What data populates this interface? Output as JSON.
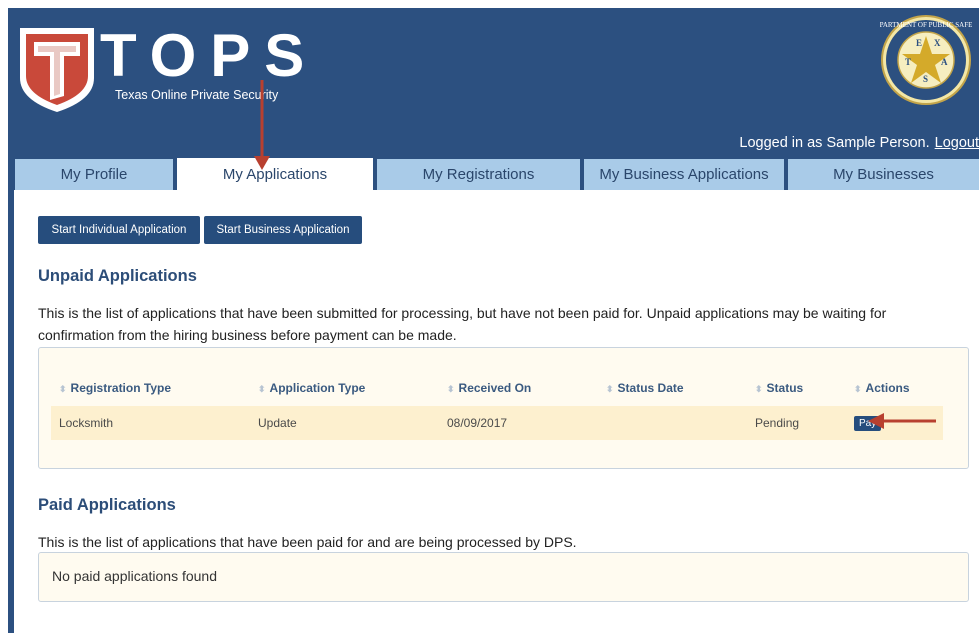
{
  "header": {
    "brand": "TOPS",
    "tagline": "Texas Online Private Security",
    "seal_top_text": "DEPARTMENT OF PUBLIC SAFETY",
    "seal_letters": [
      "E",
      "X",
      "T",
      "A",
      "S"
    ],
    "logged_in_text": "Logged in as Sample Person.",
    "logout_label": "Logout"
  },
  "tabs": [
    {
      "label": "My Profile",
      "active": false
    },
    {
      "label": "My Applications",
      "active": true
    },
    {
      "label": "My Registrations",
      "active": false
    },
    {
      "label": "My Business Applications",
      "active": false
    },
    {
      "label": "My Businesses",
      "active": false
    }
  ],
  "actions": {
    "start_individual": "Start Individual Application",
    "start_business": "Start Business Application"
  },
  "unpaid": {
    "title": "Unpaid Applications",
    "description": "This is the list of applications that have been submitted for processing, but have not been paid for. Unpaid applications may be waiting for confirmation from the hiring business before payment can be made.",
    "columns": [
      "Registration Type",
      "Application Type",
      "Received On",
      "Status Date",
      "Status",
      "Actions"
    ],
    "rows": [
      {
        "registration_type": "Locksmith",
        "application_type": "Update",
        "received_on": "08/09/2017",
        "status_date": "",
        "status": "Pending",
        "action_label": "Pay"
      }
    ]
  },
  "paid": {
    "title": "Paid Applications",
    "description": "This is the list of applications that have been paid for and are being processed by DPS.",
    "empty_message": "No paid applications found"
  },
  "colors": {
    "header_bg": "#2c5080",
    "tab_bg": "#a9cbe8",
    "button_bg": "#264d7d",
    "arrow": "#b8402f",
    "row_bg": "#fdf0cf"
  }
}
